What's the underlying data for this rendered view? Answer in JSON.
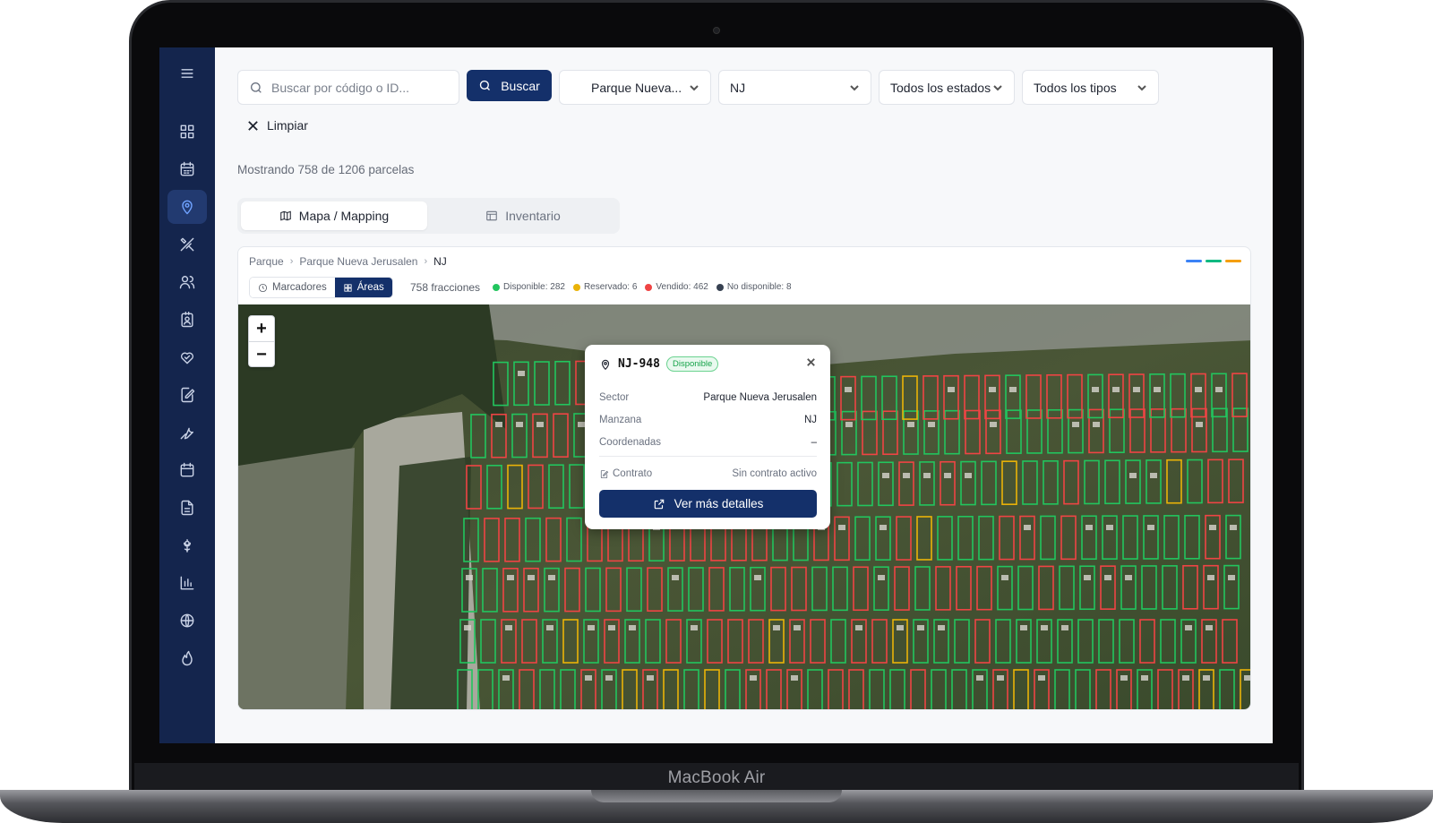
{
  "device": {
    "brand_label": "MacBook Air"
  },
  "sidebar": {
    "items": [
      {
        "icon": "menu-icon"
      },
      {
        "icon": "dashboard-icon"
      },
      {
        "icon": "calendar-icon"
      },
      {
        "icon": "map-pin-icon",
        "active": true
      },
      {
        "icon": "tools-icon"
      },
      {
        "icon": "users-icon"
      },
      {
        "icon": "contact-card-icon"
      },
      {
        "icon": "heart-handshake-icon"
      },
      {
        "icon": "edit-document-icon"
      },
      {
        "icon": "wrench-icon"
      },
      {
        "icon": "calendar-small-icon"
      },
      {
        "icon": "file-text-icon"
      },
      {
        "icon": "flower-icon"
      },
      {
        "icon": "bar-chart-icon"
      },
      {
        "icon": "globe-icon"
      },
      {
        "icon": "flame-icon"
      }
    ]
  },
  "filters": {
    "search_placeholder": "Buscar por código o ID...",
    "search_value": "",
    "search_button": "Buscar",
    "park_select": "Parque Nueva...",
    "block_select": "NJ",
    "status_select": "Todos los estados",
    "type_select": "Todos los tipos",
    "clear_label": "Limpiar"
  },
  "summary": {
    "showing_text": "Mostrando 758 de 1206 parcelas"
  },
  "tabs": [
    {
      "label": "Mapa / Mapping",
      "icon": "map-icon",
      "active": true
    },
    {
      "label": "Inventario",
      "icon": "table-icon",
      "active": false
    }
  ],
  "map_panel": {
    "breadcrumb": [
      "Parque",
      "Parque Nueva Jerusalen",
      "NJ"
    ],
    "accent_colors": [
      "#3b82f6",
      "#10b981",
      "#f59e0b"
    ],
    "view_toggle": {
      "markers": "Marcadores",
      "areas": "Áreas",
      "selected": "areas"
    },
    "fraction_count": "758 fracciones",
    "legend": [
      {
        "label": "Disponible: 282",
        "color": "#22c55e"
      },
      {
        "label": "Reservado: 6",
        "color": "#eab308"
      },
      {
        "label": "Vendido: 462",
        "color": "#ef4444"
      },
      {
        "label": "No disponible: 8",
        "color": "#374151"
      }
    ],
    "zoom": {
      "in": "+",
      "out": "−"
    }
  },
  "popup": {
    "code": "NJ-948",
    "status": "Disponible",
    "rows": [
      {
        "key": "Sector",
        "value": "Parque Nueva Jerusalen"
      },
      {
        "key": "Manzana",
        "value": "NJ"
      },
      {
        "key": "Coordenadas",
        "value": "–"
      }
    ],
    "contract": {
      "key": "Contrato",
      "value": "Sin contrato activo"
    },
    "details_button": "Ver más detalles"
  },
  "colors": {
    "sidebar_bg": "#14254d",
    "primary": "#14306a",
    "available": "#22c55e",
    "reserved": "#eab308",
    "sold": "#ef4444"
  }
}
